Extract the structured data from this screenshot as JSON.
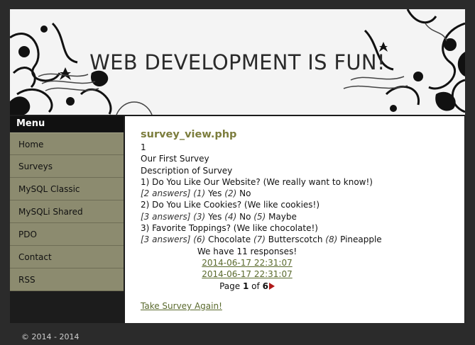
{
  "banner": {
    "title": "WEB DEVELOPMENT IS FUN!"
  },
  "menu": {
    "title": "Menu",
    "items": [
      "Home",
      "Surveys",
      "MySQL Classic",
      "MySQLi Shared",
      "PDO",
      "Contact",
      "RSS"
    ]
  },
  "content": {
    "heading": "survey_view.php",
    "survey_id": "1",
    "survey_title": "Our First Survey",
    "survey_description": "Description of Survey",
    "questions": [
      {
        "question": "1) Do You Like Our Website? (We really want to know!)",
        "answers_count": "[2 answers]",
        "answers": [
          {
            "num": "(1)",
            "text": "Yes"
          },
          {
            "num": "(2)",
            "text": "No"
          }
        ]
      },
      {
        "question": "2) Do You Like Cookies? (We like cookies!)",
        "answers_count": "[3 answers]",
        "answers": [
          {
            "num": "(3)",
            "text": "Yes"
          },
          {
            "num": "(4)",
            "text": "No"
          },
          {
            "num": "(5)",
            "text": "Maybe"
          }
        ]
      },
      {
        "question": "3) Favorite Toppings? (We like chocolate!)",
        "answers_count": "[3 answers]",
        "answers": [
          {
            "num": "(6)",
            "text": "Chocolate"
          },
          {
            "num": "(7)",
            "text": "Butterscotch"
          },
          {
            "num": "(8)",
            "text": "Pineapple"
          }
        ]
      }
    ],
    "responses_text": "We have 11 responses!",
    "response_links": [
      "2014-06-17 22:31:07",
      "2014-06-17 22:31:07"
    ],
    "pager": {
      "prefix": "Page",
      "current": "1",
      "of": "of",
      "total": "6"
    },
    "retake_label": "Take Survey Again!"
  },
  "footer": {
    "text": "© 2014 - 2014"
  },
  "colors": {
    "menu_item_bg": "#8c8b6f",
    "heading": "#7c7d3d",
    "link": "#5a6a2d",
    "pager_arrow": "#b01a1a"
  }
}
